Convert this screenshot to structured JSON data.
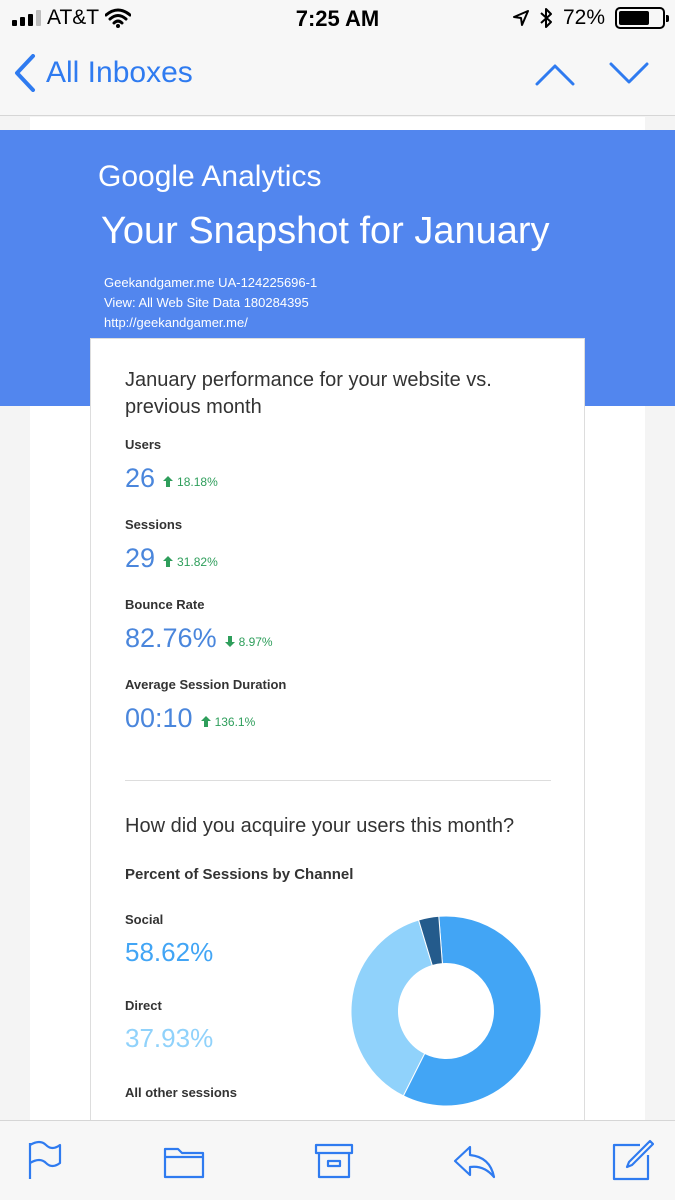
{
  "status_bar": {
    "carrier": "AT&T",
    "time": "7:25 AM",
    "battery": "72%",
    "battery_level": 0.72,
    "icons": [
      "signal-icon",
      "wifi-icon",
      "location-arrow-icon",
      "bluetooth-icon",
      "battery-icon"
    ]
  },
  "nav": {
    "back_label": "All Inboxes",
    "icons": [
      "chevron-left-icon",
      "chevron-up-icon",
      "chevron-down-icon"
    ]
  },
  "email": {
    "brand": "Google Analytics",
    "title": "Your Snapshot for January",
    "account_line": "Geekandgamer.me UA-124225696-1",
    "view_line": "View: All Web Site Data 180284395",
    "url_line": "http://geekandgamer.me/",
    "performance_heading": "January performance for your website vs. previous month",
    "metrics": [
      {
        "label": "Users",
        "value": "26",
        "change": "18.18%",
        "direction": "up"
      },
      {
        "label": "Sessions",
        "value": "29",
        "change": "31.82%",
        "direction": "up"
      },
      {
        "label": "Bounce Rate",
        "value": "82.76%",
        "change": "8.97%",
        "direction": "down"
      },
      {
        "label": "Average Session Duration",
        "value": "00:10",
        "change": "136.1%",
        "direction": "up"
      }
    ],
    "acquisition_heading": "How did you acquire your users this month?",
    "channel_heading": "Percent of Sessions by Channel",
    "channels": [
      {
        "label": "Social",
        "value": "58.62%",
        "color": "#42a5f5"
      },
      {
        "label": "Direct",
        "value": "37.93%",
        "color": "#90d2fb"
      },
      {
        "label": "All other sessions",
        "value": "",
        "color": "#245b8c"
      }
    ],
    "colors": {
      "banner": "#5286ee",
      "metric_value": "#4a86dc",
      "change_positive": "#2e9e5b"
    }
  },
  "chart_data": {
    "type": "pie",
    "title": "Percent of Sessions by Channel",
    "categories": [
      "Social",
      "Direct",
      "All other sessions"
    ],
    "values": [
      58.62,
      37.93,
      3.45
    ],
    "colors": [
      "#42a5f5",
      "#90d2fb",
      "#245b8c"
    ],
    "hole": 0.5
  },
  "toolbar": {
    "icons": [
      "flag-icon",
      "folder-icon",
      "archive-icon",
      "reply-icon",
      "compose-icon"
    ]
  }
}
